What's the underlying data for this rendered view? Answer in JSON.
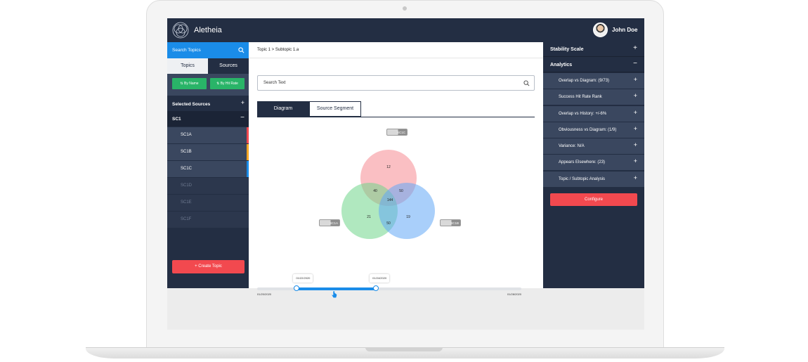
{
  "app": {
    "title": "Aletheia",
    "user_name": "John Doe"
  },
  "left_sidebar": {
    "search_label": "Search Topics",
    "tabs": [
      "Topics",
      "Sources"
    ],
    "sort_buttons": [
      "⇅ By Name",
      "⇅ By Hit Rate"
    ],
    "selected_sources_label": "Selected Sources",
    "group_label": "SC1",
    "sources": [
      {
        "label": "SC1A",
        "color": "#f2494f",
        "active": true
      },
      {
        "label": "SC1B",
        "color": "#f5a623",
        "active": true
      },
      {
        "label": "SC1C",
        "color": "#1a8ce8",
        "active": true
      },
      {
        "label": "SC1D",
        "color": "",
        "active": false
      },
      {
        "label": "SC1E",
        "color": "",
        "active": false
      },
      {
        "label": "SC1F",
        "color": "",
        "active": false
      }
    ],
    "create_button": "+ Create Topic"
  },
  "main": {
    "breadcrumb": "Topic 1 >  Subtopic 1.a",
    "search_placeholder": "Search Text",
    "tabs": [
      "Diagram",
      "Source Segment"
    ],
    "venn": {
      "chips": {
        "top": "SC1C",
        "left": "SC1A",
        "right": "SC1B"
      },
      "values": {
        "top_only": "12",
        "left_only": "21",
        "right_only": "19",
        "top_left": "40",
        "top_right": "50",
        "left_right": "50",
        "center": "144"
      },
      "colors": {
        "top": "#f68a92",
        "left": "#6fd58a",
        "right": "#62a8f5"
      }
    },
    "timeline": {
      "start_date": "01/20/2020",
      "end_date": "01/28/2020",
      "handle_low_label": "01/22/2020",
      "handle_high_label": "01/24/2020",
      "low_fraction": 0.15,
      "high_fraction": 0.45
    }
  },
  "right_sidebar": {
    "stability_label": "Stability Scale",
    "analytics_label": "Analytics",
    "items": [
      "Overlap vs Diagram: (9/73)",
      "Success Hit Rate Rank",
      "Overlap vs History: +/-6%",
      "Obviousness vs Diagram: (1/9)",
      "Variance: N/A",
      "Appears Elsewhere: (23)",
      "Topic / Subtopic Analysis"
    ],
    "configure_button": "Configure"
  }
}
